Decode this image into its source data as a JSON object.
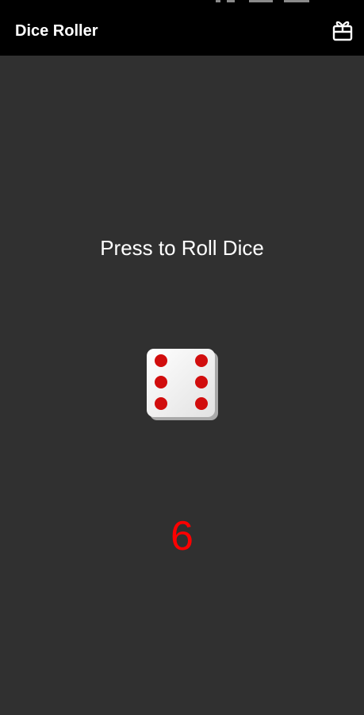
{
  "app_bar": {
    "title": "Dice Roller",
    "action_icon": "present-gift-icon"
  },
  "main": {
    "prompt": "Press to Roll Dice",
    "die_face": 6,
    "die_icon": "die-six-icon",
    "result": "6"
  },
  "colors": {
    "app_bar_background": "#000000",
    "content_background": "#303030",
    "prompt_text": "#ffffff",
    "result_text": "#ff0000",
    "pip": "#d10d0d"
  }
}
